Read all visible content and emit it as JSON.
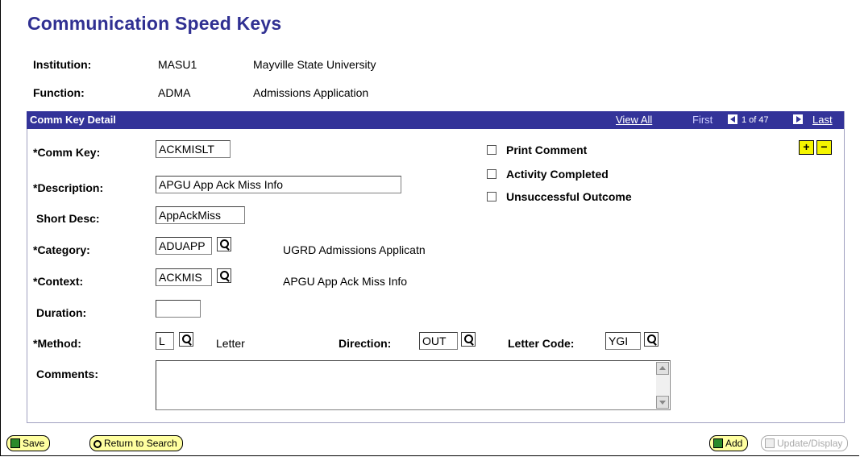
{
  "page_title": "Communication Speed Keys",
  "header": {
    "institution_label": "Institution:",
    "institution_code": "MASU1",
    "institution_name": "Mayville State University",
    "function_label": "Function:",
    "function_code": "ADMA",
    "function_name": "Admissions Application"
  },
  "section": {
    "title": "Comm Key Detail",
    "view_all": "View All",
    "first": "First",
    "page_counter": "1 of 47",
    "last": "Last"
  },
  "form": {
    "comm_key_label": "*Comm Key:",
    "comm_key_value": "ACKMISLT",
    "description_label": "*Description:",
    "description_value": "APGU App Ack Miss Info",
    "short_desc_label": "Short Desc:",
    "short_desc_value": "AppAckMiss",
    "category_label": "*Category:",
    "category_value": "ADUAPP",
    "category_desc": "UGRD Admissions Applicatn",
    "context_label": "*Context:",
    "context_value": "ACKMIS",
    "context_desc": "APGU App Ack Miss Info",
    "duration_label": "Duration:",
    "duration_value": "",
    "method_label": "*Method:",
    "method_value": "L",
    "method_desc": "Letter",
    "direction_label": "Direction:",
    "direction_value": "OUT",
    "letter_code_label": "Letter Code:",
    "letter_code_value": "YGI",
    "comments_label": "Comments:",
    "comments_value": ""
  },
  "checkboxes": {
    "print_comment": "Print Comment",
    "activity_completed": "Activity Completed",
    "unsuccessful_outcome": "Unsuccessful Outcome"
  },
  "row_buttons": {
    "add": "+",
    "remove": "−"
  },
  "footer": {
    "save": "Save",
    "return_to_search": "Return to Search",
    "add": "Add",
    "update_display": "Update/Display"
  }
}
